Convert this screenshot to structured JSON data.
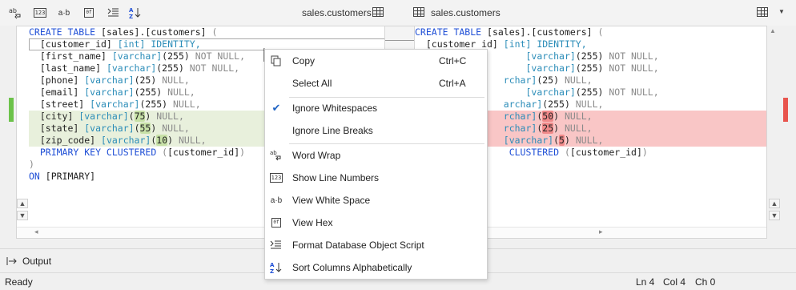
{
  "toolbar": {
    "icons": [
      "word-wrap-icon",
      "line-numbers-icon",
      "white-space-icon",
      "hex-icon",
      "format-icon",
      "sort-icon"
    ],
    "left_title": "sales.customers",
    "right_title": "sales.customers"
  },
  "left_code": [
    [
      {
        "t": "CREATE TABLE ",
        "c": "kw"
      },
      {
        "t": "[sales].[customers] ",
        "c": "tx"
      },
      {
        "t": "(",
        "c": "gr"
      }
    ],
    [
      {
        "t": "  [customer_id] ",
        "c": "tx"
      },
      {
        "t": "[int] IDENTITY,",
        "c": "ty"
      }
    ],
    [
      {
        "t": "  [first_name] ",
        "c": "tx"
      },
      {
        "t": "[varchar]",
        "c": "ty"
      },
      {
        "t": "(255) ",
        "c": "tx"
      },
      {
        "t": "NOT NULL,",
        "c": "gr"
      }
    ],
    [
      {
        "t": "  [last_name] ",
        "c": "tx"
      },
      {
        "t": "[varchar]",
        "c": "ty"
      },
      {
        "t": "(255) ",
        "c": "tx"
      },
      {
        "t": "NOT NULL,",
        "c": "gr"
      }
    ],
    [
      {
        "t": "  [phone] ",
        "c": "tx"
      },
      {
        "t": "[varchar]",
        "c": "ty"
      },
      {
        "t": "(25) ",
        "c": "tx"
      },
      {
        "t": "NULL,",
        "c": "gr"
      }
    ],
    [
      {
        "t": "  [email] ",
        "c": "tx"
      },
      {
        "t": "[varchar]",
        "c": "ty"
      },
      {
        "t": "(255) ",
        "c": "tx"
      },
      {
        "t": "NULL,",
        "c": "gr"
      }
    ],
    [
      {
        "t": "  [street] ",
        "c": "tx"
      },
      {
        "t": "[varchar]",
        "c": "ty"
      },
      {
        "t": "(255) ",
        "c": "tx"
      },
      {
        "t": "NULL,",
        "c": "gr"
      }
    ],
    [
      {
        "t": "  [city] ",
        "c": "tx"
      },
      {
        "t": "[varchar]",
        "c": "ty"
      },
      {
        "t": "(",
        "c": "tx"
      },
      {
        "t": "75",
        "c": "tx",
        "x": "chg"
      },
      {
        "t": ") ",
        "c": "tx"
      },
      {
        "t": "NULL,",
        "c": "gr"
      }
    ],
    [
      {
        "t": "  [state] ",
        "c": "tx"
      },
      {
        "t": "[varchar]",
        "c": "ty"
      },
      {
        "t": "(",
        "c": "tx"
      },
      {
        "t": "55",
        "c": "tx",
        "x": "chg"
      },
      {
        "t": ") ",
        "c": "tx"
      },
      {
        "t": "NULL,",
        "c": "gr"
      }
    ],
    [
      {
        "t": "  [zip_code] ",
        "c": "tx"
      },
      {
        "t": "[varchar]",
        "c": "ty"
      },
      {
        "t": "(",
        "c": "tx"
      },
      {
        "t": "10",
        "c": "tx",
        "x": "chg"
      },
      {
        "t": ") ",
        "c": "tx"
      },
      {
        "t": "NULL,",
        "c": "gr"
      }
    ],
    [
      {
        "t": "  PRIMARY KEY CLUSTERED ",
        "c": "kw"
      },
      {
        "t": "(",
        "c": "gr"
      },
      {
        "t": "[customer_id]",
        "c": "tx"
      },
      {
        "t": ")",
        "c": "gr"
      }
    ],
    [
      {
        "t": ")",
        "c": "gr"
      }
    ],
    [
      {
        "t": "ON ",
        "c": "kw"
      },
      {
        "t": "[PRIMARY]",
        "c": "tx"
      }
    ]
  ],
  "right_code": [
    [
      {
        "t": "CREATE TABLE ",
        "c": "kw"
      },
      {
        "t": "[sales].[customers] ",
        "c": "tx"
      },
      {
        "t": "(",
        "c": "gr"
      }
    ],
    [
      {
        "t": "  [customer_id] ",
        "c": "tx"
      },
      {
        "t": "[int] IDENTITY,",
        "c": "ty"
      }
    ],
    [
      {
        "t": "                    ",
        "c": "tx"
      },
      {
        "t": "[varchar]",
        "c": "ty"
      },
      {
        "t": "(255) ",
        "c": "tx"
      },
      {
        "t": "NOT NULL,",
        "c": "gr"
      }
    ],
    [
      {
        "t": "                    ",
        "c": "tx"
      },
      {
        "t": "[varchar]",
        "c": "ty"
      },
      {
        "t": "(255) ",
        "c": "tx"
      },
      {
        "t": "NOT NULL,",
        "c": "gr"
      }
    ],
    [
      {
        "t": "                ",
        "c": "tx"
      },
      {
        "t": "rchar]",
        "c": "ty"
      },
      {
        "t": "(25) ",
        "c": "tx"
      },
      {
        "t": "NULL,",
        "c": "gr"
      }
    ],
    [
      {
        "t": "                    ",
        "c": "tx"
      },
      {
        "t": "[varchar]",
        "c": "ty"
      },
      {
        "t": "(255) ",
        "c": "tx"
      },
      {
        "t": "NOT NULL,",
        "c": "gr"
      }
    ],
    [
      {
        "t": "                ",
        "c": "tx"
      },
      {
        "t": "archar]",
        "c": "ty"
      },
      {
        "t": "(255) ",
        "c": "tx"
      },
      {
        "t": "NULL,",
        "c": "gr"
      }
    ],
    [
      {
        "t": "                ",
        "c": "tx"
      },
      {
        "t": "rchar]",
        "c": "ty"
      },
      {
        "t": "(",
        "c": "tx"
      },
      {
        "t": "50",
        "c": "tx",
        "x": "chr"
      },
      {
        "t": ") ",
        "c": "tx"
      },
      {
        "t": "NULL,",
        "c": "gr"
      }
    ],
    [
      {
        "t": "                ",
        "c": "tx"
      },
      {
        "t": "rchar]",
        "c": "ty"
      },
      {
        "t": "(",
        "c": "tx"
      },
      {
        "t": "25",
        "c": "tx",
        "x": "chr"
      },
      {
        "t": ") ",
        "c": "tx"
      },
      {
        "t": "NULL,",
        "c": "gr"
      }
    ],
    [
      {
        "t": "                ",
        "c": "tx"
      },
      {
        "t": "[varchar]",
        "c": "ty"
      },
      {
        "t": "(",
        "c": "tx"
      },
      {
        "t": "5",
        "c": "tx",
        "x": "chr"
      },
      {
        "t": ") ",
        "c": "tx"
      },
      {
        "t": "NULL,",
        "c": "gr"
      }
    ],
    [
      {
        "t": "                 ",
        "c": "tx"
      },
      {
        "t": "CLUSTERED ",
        "c": "kw"
      },
      {
        "t": "(",
        "c": "gr"
      },
      {
        "t": "[customer_id]",
        "c": "tx"
      },
      {
        "t": ")",
        "c": "gr"
      }
    ]
  ],
  "context_menu": {
    "items": [
      {
        "label": "Copy",
        "shortcut": "Ctrl+C",
        "icon": "copy-icon",
        "name": "menu-item-copy"
      },
      {
        "label": "Select All",
        "shortcut": "Ctrl+A",
        "icon": "",
        "name": "menu-item-select-all"
      },
      {
        "label": "Ignore Whitespaces",
        "shortcut": "",
        "icon": "checkmark-icon",
        "name": "menu-item-ignore-whitespaces",
        "checked": true
      },
      {
        "label": "Ignore Line Breaks",
        "shortcut": "",
        "icon": "",
        "name": "menu-item-ignore-line-breaks"
      },
      {
        "label": "Word Wrap",
        "shortcut": "",
        "icon": "word-wrap-icon",
        "name": "menu-item-word-wrap"
      },
      {
        "label": "Show Line Numbers",
        "shortcut": "",
        "icon": "line-numbers-icon",
        "name": "menu-item-show-line-numbers"
      },
      {
        "label": "View White Space",
        "shortcut": "",
        "icon": "white-space-icon",
        "name": "menu-item-view-white-space"
      },
      {
        "label": "View Hex",
        "shortcut": "",
        "icon": "hex-icon",
        "name": "menu-item-view-hex"
      },
      {
        "label": "Format Database Object Script",
        "shortcut": "",
        "icon": "format-icon",
        "name": "menu-item-format-script"
      },
      {
        "label": "Sort Columns Alphabetically",
        "shortcut": "",
        "icon": "sort-icon",
        "name": "menu-item-sort-columns"
      }
    ]
  },
  "output": {
    "label": "Output"
  },
  "status": {
    "text": "Ready",
    "ln": "Ln 4",
    "col": "Col 4",
    "ch": "Ch 0"
  },
  "colors": {
    "keyword": "#1f4fd6",
    "type": "#2a8cb8",
    "added_bg": "#e8f0dc",
    "removed_bg": "#f9c6c6",
    "added_mark": "#6cc24a",
    "removed_mark": "#e8554e"
  }
}
